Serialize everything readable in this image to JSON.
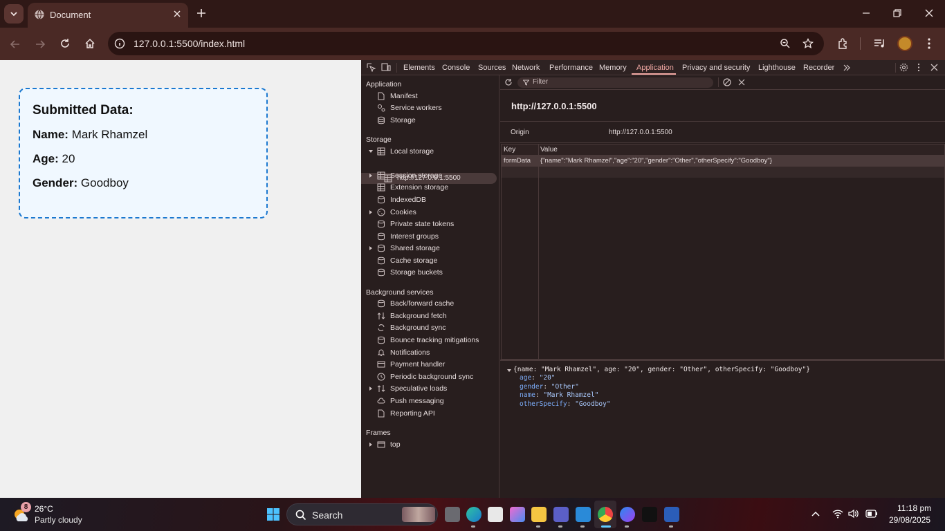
{
  "browser": {
    "tab_title": "Document",
    "url": "127.0.0.1:5500/index.html"
  },
  "card": {
    "heading": "Submitted Data:",
    "name_label": "Name:",
    "name_value": "Mark Rhamzel",
    "age_label": "Age:",
    "age_value": "20",
    "gender_label": "Gender:",
    "gender_value": "Goodboy"
  },
  "devtools": {
    "tabs": [
      "Elements",
      "Console",
      "Sources",
      "Network",
      "Performance",
      "Memory",
      "Application",
      "Privacy and security",
      "Lighthouse",
      "Recorder"
    ],
    "active_tab": "Application",
    "sidebar": {
      "application_header": "Application",
      "application_items": [
        "Manifest",
        "Service workers",
        "Storage"
      ],
      "storage_header": "Storage",
      "storage_items": [
        "Local storage",
        "http://127.0.0.1:5500",
        "Session storage",
        "Extension storage",
        "IndexedDB",
        "Cookies",
        "Private state tokens",
        "Interest groups",
        "Shared storage",
        "Cache storage",
        "Storage buckets"
      ],
      "background_header": "Background services",
      "background_items": [
        "Back/forward cache",
        "Background fetch",
        "Background sync",
        "Bounce tracking mitigations",
        "Notifications",
        "Payment handler",
        "Periodic background sync",
        "Speculative loads",
        "Push messaging",
        "Reporting API"
      ],
      "frames_header": "Frames",
      "frames_items": [
        "top"
      ]
    },
    "filter_placeholder": "Filter",
    "origin_title": "http://127.0.0.1:5500",
    "origin_label": "Origin",
    "origin_value": "http://127.0.0.1:5500",
    "table": {
      "headers": [
        "Key",
        "Value"
      ],
      "rows": [
        {
          "key": "formData",
          "value": "{\"name\":\"Mark Rhamzel\",\"age\":\"20\",\"gender\":\"Other\",\"otherSpecify\":\"Goodboy\"}"
        }
      ]
    },
    "preview": {
      "summary": "{name: \"Mark Rhamzel\", age: \"20\", gender: \"Other\", otherSpecify: \"Goodboy\"}",
      "props": [
        {
          "k": "age",
          "v": "\"20\""
        },
        {
          "k": "gender",
          "v": "\"Other\""
        },
        {
          "k": "name",
          "v": "\"Mark Rhamzel\""
        },
        {
          "k": "otherSpecify",
          "v": "\"Goodboy\""
        }
      ]
    }
  },
  "taskbar": {
    "weather_badge": "8",
    "temperature": "26°C",
    "condition": "Partly cloudy",
    "search_label": "Search",
    "time": "11:18 pm",
    "date": "29/08/2025"
  }
}
